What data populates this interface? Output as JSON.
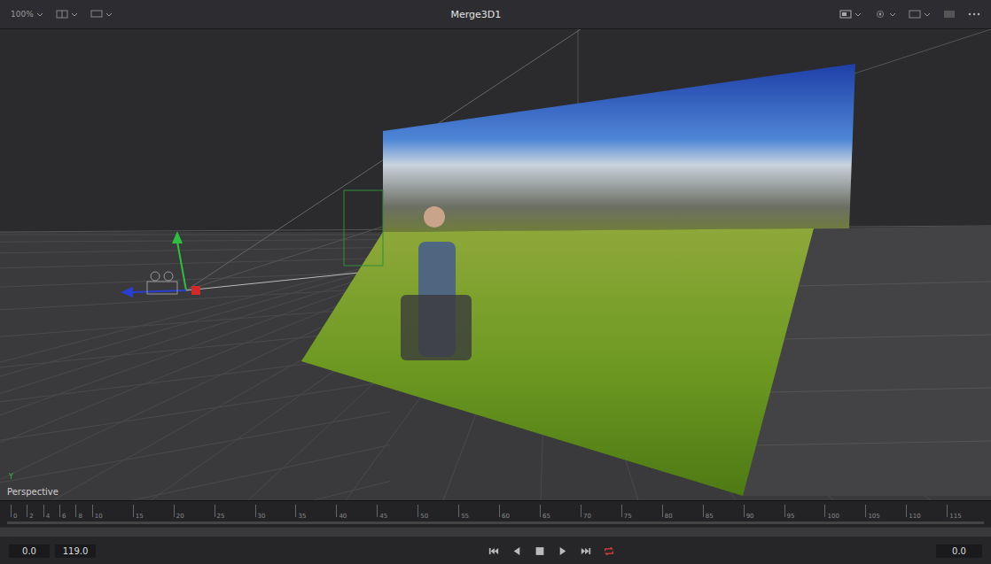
{
  "viewer": {
    "title": "Merge3D1",
    "zoom": "100%"
  },
  "viewport": {
    "label": "Perspective",
    "axis_label": "Y"
  },
  "timeline": {
    "ticks": [
      "0",
      "2",
      "4",
      "6",
      "8",
      "10",
      "15",
      "20",
      "25",
      "30",
      "35",
      "40",
      "45",
      "50",
      "55",
      "60",
      "65",
      "70",
      "75",
      "80",
      "85",
      "90",
      "95",
      "100",
      "105",
      "110",
      "115"
    ]
  },
  "range": {
    "start": "0.0",
    "end": "119.0"
  },
  "transport": {
    "loop": true
  },
  "current_time": "0.0"
}
